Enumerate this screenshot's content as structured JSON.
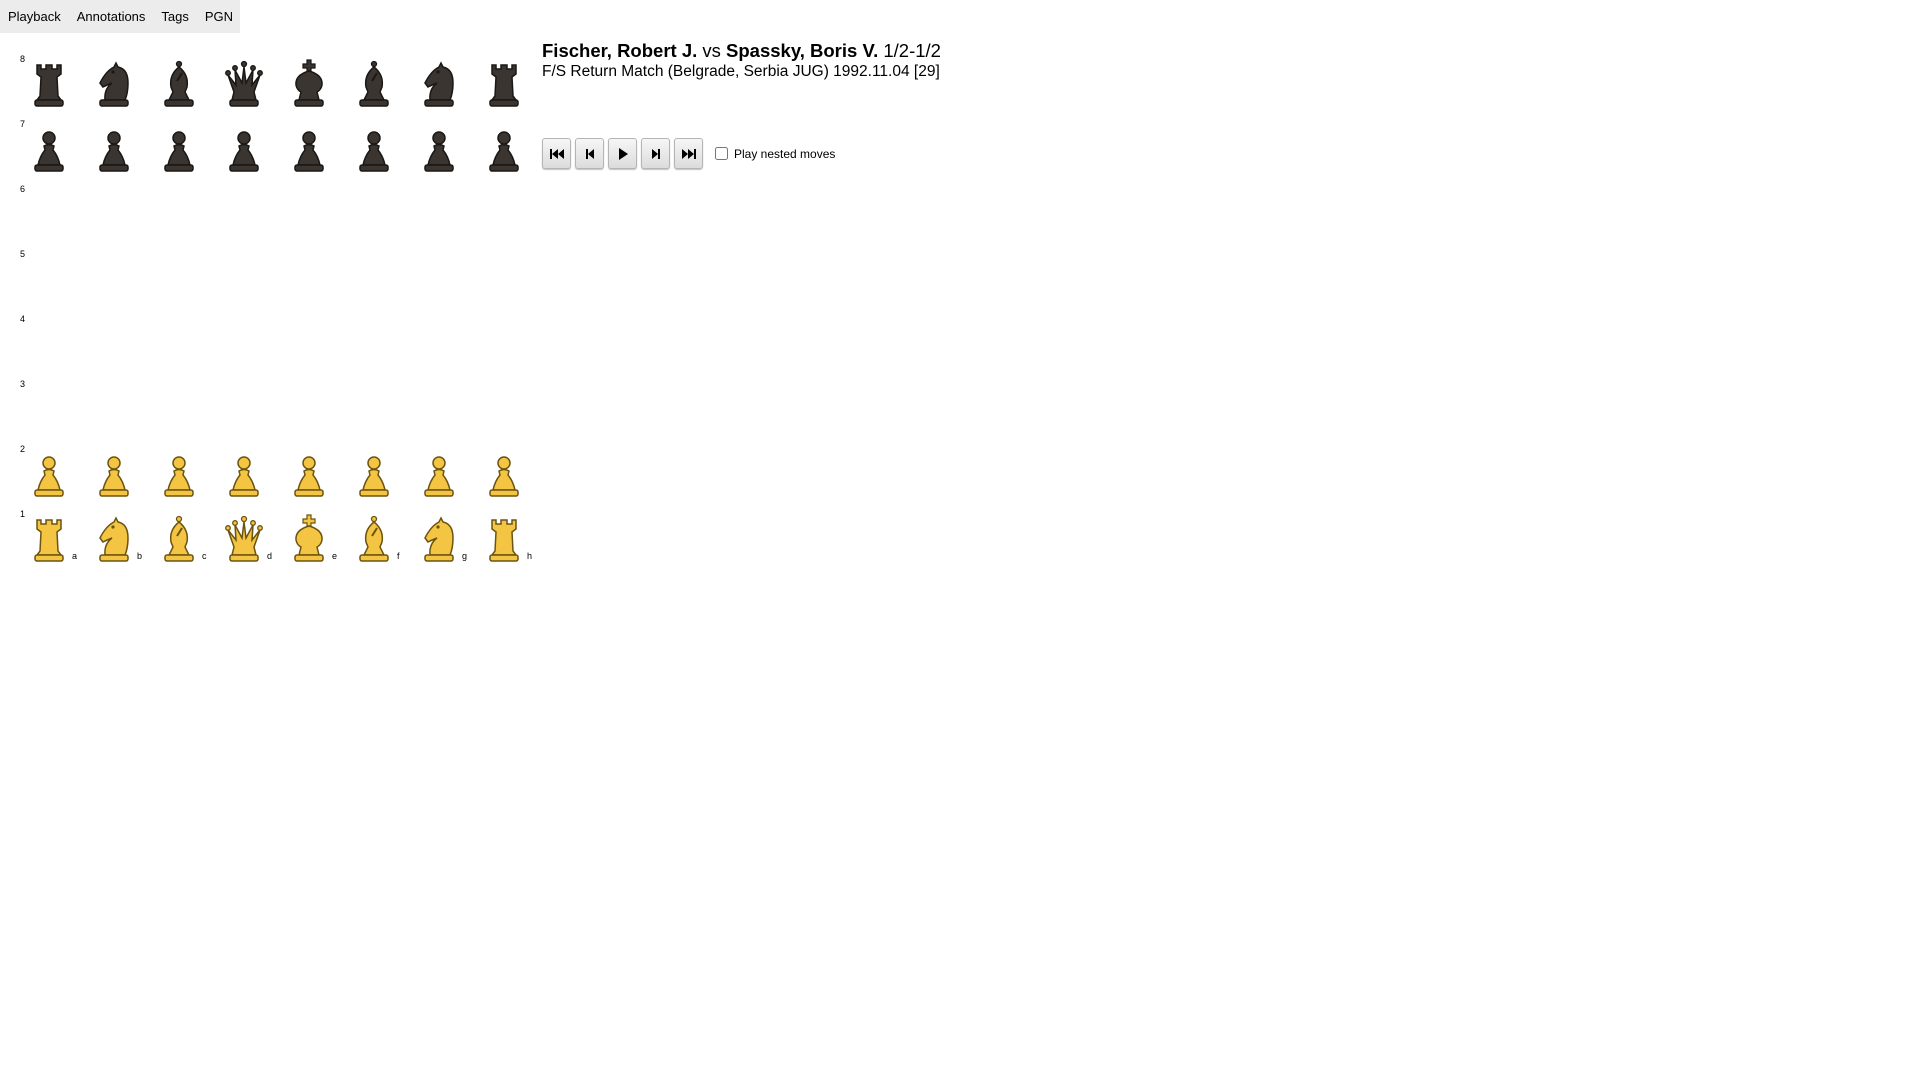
{
  "menu": {
    "items": [
      "Playback",
      "Annotations",
      "Tags",
      "PGN"
    ]
  },
  "game": {
    "white": "Fischer, Robert J.",
    "vs": "vs",
    "black": "Spassky, Boris V.",
    "result": "1/2-1/2",
    "event_line": "F/S Return Match (Belgrade, Serbia JUG) 1992.11.04 [29]"
  },
  "board": {
    "ranks": [
      "8",
      "7",
      "6",
      "5",
      "4",
      "3",
      "2",
      "1"
    ],
    "files": [
      "a",
      "b",
      "c",
      "d",
      "e",
      "f",
      "g",
      "h"
    ],
    "position": [
      [
        "br",
        "bn",
        "bb",
        "bq",
        "bk",
        "bb",
        "bn",
        "br"
      ],
      [
        "bp",
        "bp",
        "bp",
        "bp",
        "bp",
        "bp",
        "bp",
        "bp"
      ],
      [
        "",
        "",
        "",
        "",
        "",
        "",
        "",
        ""
      ],
      [
        "",
        "",
        "",
        "",
        "",
        "",
        "",
        ""
      ],
      [
        "",
        "",
        "",
        "",
        "",
        "",
        "",
        ""
      ],
      [
        "",
        "",
        "",
        "",
        "",
        "",
        "",
        ""
      ],
      [
        "wp",
        "wp",
        "wp",
        "wp",
        "wp",
        "wp",
        "wp",
        "wp"
      ],
      [
        "wr",
        "wn",
        "wb",
        "wq",
        "wk",
        "wb",
        "wn",
        "wr"
      ]
    ],
    "colors": {
      "white_fill": "#f4c542",
      "white_stroke": "#6b5310",
      "black_fill": "#3a3530",
      "black_stroke": "#1a1714"
    }
  },
  "controls": {
    "buttons": [
      "first-move-icon",
      "previous-move-icon",
      "play-icon",
      "next-move-icon",
      "last-move-icon"
    ],
    "nested_label": "Play nested moves",
    "nested_checked": false
  }
}
